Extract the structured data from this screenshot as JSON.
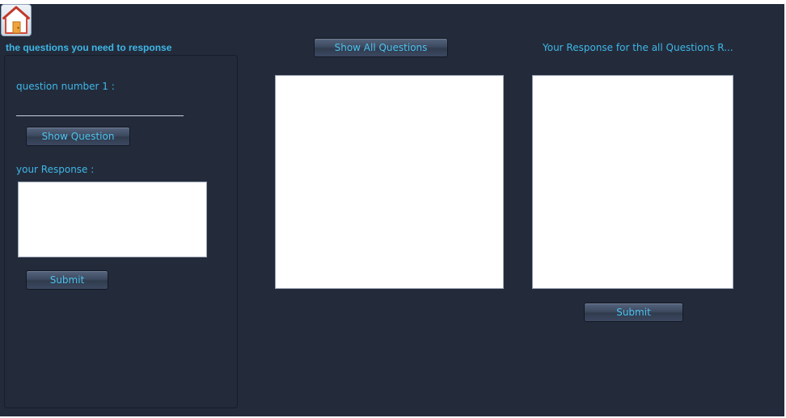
{
  "home": {
    "icon": "home-icon"
  },
  "left": {
    "header": "the questions you need to response",
    "question_label": "question number 1 :",
    "question_input_value": "",
    "show_question_button": "Show Question",
    "response_label": "your Response :",
    "response_text": "",
    "submit_button": "Submit"
  },
  "middle": {
    "show_all_button": "Show All Questions",
    "all_questions_text": ""
  },
  "right": {
    "header": "Your Response for the all Questions R...",
    "all_responses_text": "",
    "submit_button": "Submit"
  },
  "colors": {
    "background": "#232b3b",
    "accent_text": "#3fb7e6"
  }
}
